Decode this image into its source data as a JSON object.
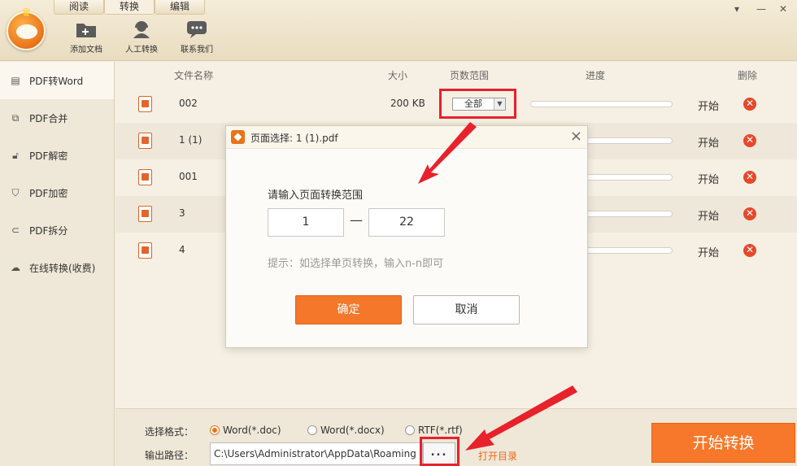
{
  "tabs": [
    "阅读",
    "转换",
    "编辑"
  ],
  "toolbar": {
    "add_doc": "添加文档",
    "manual_convert": "人工转换",
    "contact_us": "联系我们"
  },
  "sidebar": {
    "items": [
      {
        "label": "PDF转Word",
        "icon": "word-doc-icon"
      },
      {
        "label": "PDF合并",
        "icon": "merge-icon"
      },
      {
        "label": "PDF解密",
        "icon": "unlock-icon"
      },
      {
        "label": "PDF加密",
        "icon": "shield-icon"
      },
      {
        "label": "PDF拆分",
        "icon": "split-icon"
      },
      {
        "label": "在线转换(收费)",
        "icon": "cloud-icon"
      }
    ]
  },
  "table": {
    "headers": {
      "name": "文件名称",
      "size": "大小",
      "range": "页数范围",
      "progress": "进度",
      "delete": "删除"
    },
    "rows": [
      {
        "name": "002",
        "size": "200 KB",
        "range": "全部",
        "action": "开始"
      },
      {
        "name": "1 (1)",
        "action": "开始"
      },
      {
        "name": "001",
        "action": "开始"
      },
      {
        "name": "3",
        "action": "开始"
      },
      {
        "name": "4",
        "action": "开始"
      }
    ]
  },
  "dialog": {
    "title": "页面选择: 1 (1).pdf",
    "prompt": "请输入页面转换范围",
    "from": "1",
    "to": "22",
    "hint": "提示：如选择单页转换，输入n-n即可",
    "ok": "确定",
    "cancel": "取消"
  },
  "bottom": {
    "format_label": "选择格式：",
    "formats": [
      {
        "label": "Word(*.doc)",
        "selected": true
      },
      {
        "label": "Word(*.docx)",
        "selected": false
      },
      {
        "label": "RTF(*.rtf)",
        "selected": false
      }
    ],
    "path_label": "输出路径：",
    "path_value": "C:\\Users\\Administrator\\AppData\\Roaming",
    "browse": "...",
    "open_dir": "打开目录",
    "start_convert": "开始转换"
  },
  "colors": {
    "accent": "#f4772a",
    "annotation": "#e8212b",
    "delete": "#e6482b"
  }
}
